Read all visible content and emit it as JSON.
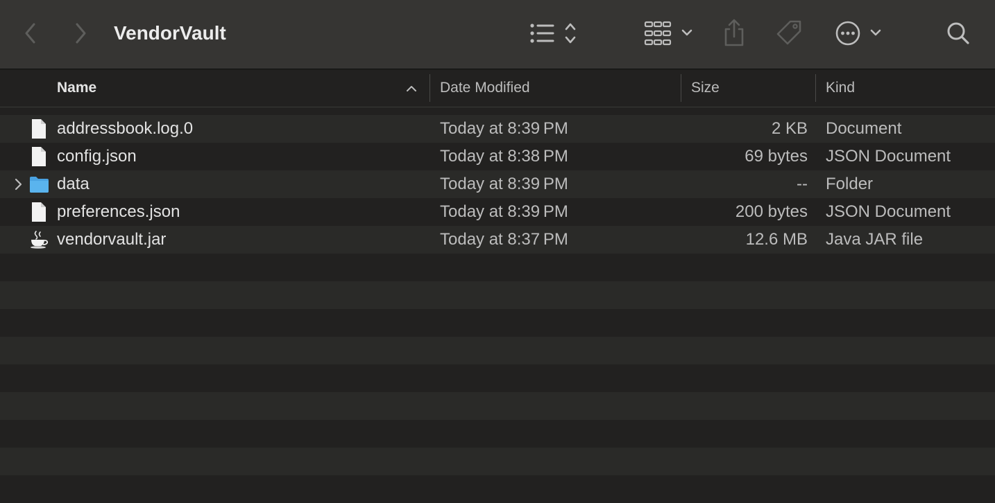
{
  "window": {
    "title": "VendorVault"
  },
  "toolbar": {
    "back_icon": "chevron-left-icon",
    "forward_icon": "chevron-right-icon",
    "view_icon": "list-view-icon",
    "group_icon": "grid-group-icon",
    "share_icon": "share-icon",
    "tag_icon": "tag-icon",
    "more_icon": "ellipsis-circle-icon",
    "search_icon": "search-icon"
  },
  "columns": {
    "name": "Name",
    "date": "Date Modified",
    "size": "Size",
    "kind": "Kind"
  },
  "files": [
    {
      "name": "addressbook.log.0",
      "date": "Today at 8:39 PM",
      "size": "2 KB",
      "kind": "Document",
      "icon": "document-icon"
    },
    {
      "name": "config.json",
      "date": "Today at 8:38 PM",
      "size": "69 bytes",
      "kind": "JSON Document",
      "icon": "document-icon"
    },
    {
      "name": "data",
      "date": "Today at 8:39 PM",
      "size": "--",
      "kind": "Folder",
      "icon": "folder-icon"
    },
    {
      "name": "preferences.json",
      "date": "Today at 8:39 PM",
      "size": "200 bytes",
      "kind": "JSON Document",
      "icon": "document-icon"
    },
    {
      "name": "vendorvault.jar",
      "date": "Today at 8:37 PM",
      "size": "12.6 MB",
      "kind": "Java JAR file",
      "icon": "java-coffee-icon"
    }
  ],
  "colors": {
    "toolbar_bg": "#363533",
    "row_odd": "#2a2a28",
    "row_even": "#222120",
    "folder_blue": "#5ab4ee"
  }
}
